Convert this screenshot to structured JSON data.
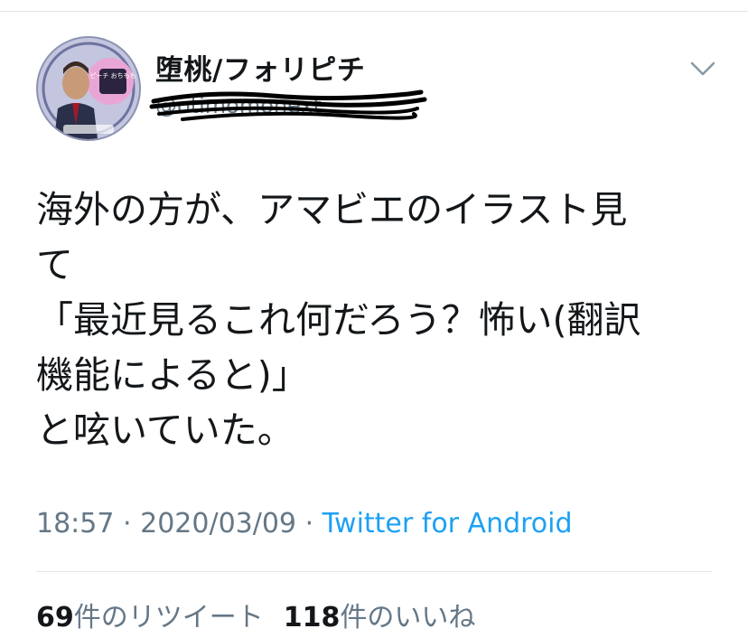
{
  "tweet": {
    "author": {
      "display_name": "堕桃/フォリピチ",
      "handle": "@otimomonext",
      "avatar_badge": "ピーチ おちもも"
    },
    "text_lines": [
      "海外の方が、アマビエのイラスト見",
      "て",
      "「最近見るこれ何だろう？怖い(翻訳",
      "機能によると)」",
      "と呟いていた。"
    ],
    "time": "18:57",
    "separator": "·",
    "date": "2020/03/09",
    "source": "Twitter for Android",
    "retweet_count": "69",
    "retweet_label": "件のリツイート",
    "like_count": "118",
    "like_label": "件のいいね"
  },
  "icons": {
    "menu": "chevron-down-icon"
  },
  "colors": {
    "link": "#1da1f2",
    "secondary_text": "#657786",
    "divider": "#e1e8ed"
  }
}
